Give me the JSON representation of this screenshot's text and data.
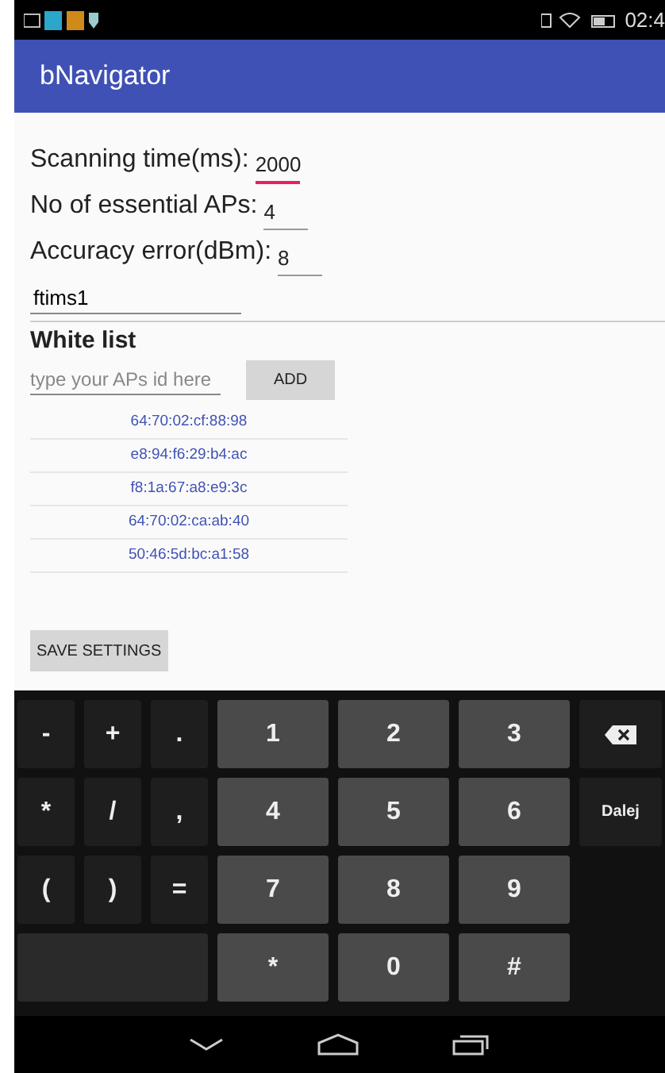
{
  "status_bar": {
    "time": "02:4"
  },
  "app_bar": {
    "title": "bNavigator"
  },
  "settings": [
    {
      "label": "Scanning time(ms):",
      "value": "2000",
      "focused": true
    },
    {
      "label": "No of essential APs:",
      "value": "4",
      "focused": false
    },
    {
      "label": "Accuracy error(dBm):",
      "value": "8",
      "focused": false
    }
  ],
  "network_field": {
    "value": "ftims1"
  },
  "white_list": {
    "title": "White list",
    "placeholder": "type your APs id here",
    "add_button": "ADD",
    "items": [
      "64:70:02:cf:88:98",
      "e8:94:f6:29:b4:ac",
      "f8:1a:67:a8:e9:3c",
      "64:70:02:ca:ab:40",
      "50:46:5d:bc:a1:58"
    ]
  },
  "save_button": "SAVE SETTINGS",
  "keyboard": {
    "rows": [
      [
        {
          "kind": "symbol",
          "label": "-"
        },
        {
          "kind": "symbol",
          "label": "+"
        },
        {
          "kind": "symbol",
          "label": "."
        },
        {
          "kind": "digit",
          "label": "1"
        },
        {
          "kind": "digit",
          "label": "2"
        },
        {
          "kind": "digit",
          "label": "3"
        },
        {
          "kind": "backspace"
        }
      ],
      [
        {
          "kind": "symbol",
          "label": "*"
        },
        {
          "kind": "symbol",
          "label": "/"
        },
        {
          "kind": "symbol",
          "label": ","
        },
        {
          "kind": "digit",
          "label": "4"
        },
        {
          "kind": "digit",
          "label": "5"
        },
        {
          "kind": "digit",
          "label": "6"
        },
        {
          "kind": "action",
          "label": "Dalej"
        }
      ],
      [
        {
          "kind": "symbol",
          "label": "("
        },
        {
          "kind": "symbol",
          "label": ")"
        },
        {
          "kind": "symbol",
          "label": "="
        },
        {
          "kind": "digit",
          "label": "7"
        },
        {
          "kind": "digit",
          "label": "8"
        },
        {
          "kind": "digit",
          "label": "9"
        },
        {
          "kind": "empty"
        }
      ],
      [
        {
          "kind": "space"
        },
        "",
        "",
        {
          "kind": "digit",
          "label": "*"
        },
        {
          "kind": "digit",
          "label": "0"
        },
        {
          "kind": "digit",
          "label": "#"
        },
        {
          "kind": "empty"
        }
      ]
    ]
  }
}
